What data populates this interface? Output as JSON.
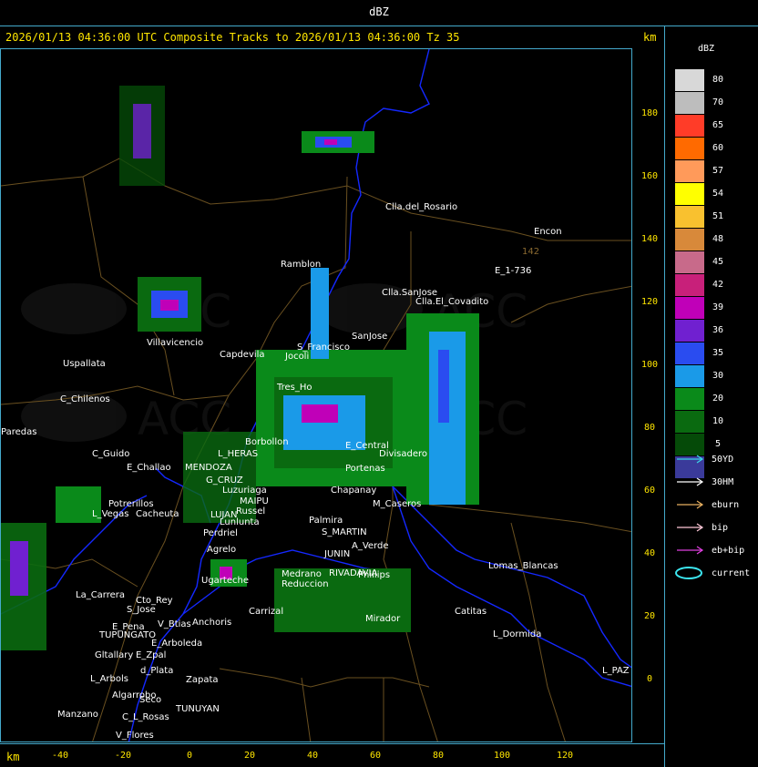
{
  "app": {
    "title": "dBZ"
  },
  "header": {
    "text": "2026/01/13 04:36:00 UTC Composite Tracks to 2026/01/13 04:36:00 Tz 35",
    "km_top": "km",
    "km_bottom": "km"
  },
  "y_ticks": [
    {
      "label": "180",
      "value": 180
    },
    {
      "label": "160",
      "value": 160
    },
    {
      "label": "140",
      "value": 140
    },
    {
      "label": "120",
      "value": 120
    },
    {
      "label": "100",
      "value": 100
    },
    {
      "label": "80",
      "value": 80
    },
    {
      "label": "60",
      "value": 60
    },
    {
      "label": "40",
      "value": 40
    },
    {
      "label": "20",
      "value": 20
    },
    {
      "label": "0",
      "value": 0
    }
  ],
  "x_ticks": [
    {
      "label": "-40",
      "value": -40
    },
    {
      "label": "-20",
      "value": -20
    },
    {
      "label": "0",
      "value": 0
    },
    {
      "label": "20",
      "value": 20
    },
    {
      "label": "40",
      "value": 40
    },
    {
      "label": "60",
      "value": 60
    },
    {
      "label": "80",
      "value": 80
    },
    {
      "label": "100",
      "value": 100
    },
    {
      "label": "120",
      "value": 120
    }
  ],
  "legend": {
    "title": "dBZ",
    "bins": [
      {
        "label": "80",
        "color": "#d8d8d8"
      },
      {
        "label": "70",
        "color": "#bdbdbd"
      },
      {
        "label": "65",
        "color": "#ff3c28"
      },
      {
        "label": "60",
        "color": "#ff6a00"
      },
      {
        "label": "57",
        "color": "#ff9a5a"
      },
      {
        "label": "54",
        "color": "#ffff00"
      },
      {
        "label": "51",
        "color": "#f9c12f"
      },
      {
        "label": "48",
        "color": "#d8893a"
      },
      {
        "label": "45",
        "color": "#c86a8a"
      },
      {
        "label": "42",
        "color": "#c8207a"
      },
      {
        "label": "39",
        "color": "#c000b8"
      },
      {
        "label": "36",
        "color": "#7020d0"
      },
      {
        "label": "35",
        "color": "#2a4cf0"
      },
      {
        "label": "30",
        "color": "#1a9ae8"
      },
      {
        "label": "20",
        "color": "#0a8a1a"
      },
      {
        "label": "10",
        "color": "#0a6a10"
      },
      {
        "label": "5",
        "color": "#054a08"
      },
      {
        "label": "",
        "color": "#3a3a9a"
      }
    ],
    "tracks": [
      {
        "label": "50YD",
        "color": "#3cd6e6"
      },
      {
        "label": "30HM",
        "color": "#ffffff"
      },
      {
        "label": "eburn",
        "color": "#e8b060"
      },
      {
        "label": "bip",
        "color": "#ffc8d8"
      },
      {
        "label": "eb+bip",
        "color": "#e040e0"
      },
      {
        "label": "current",
        "color": "#3ce6f0"
      }
    ]
  },
  "places": [
    {
      "name": "Clla.del_Rosario"
    },
    {
      "name": "Encon"
    },
    {
      "name": "142"
    },
    {
      "name": "E_1-736"
    },
    {
      "name": "Ramblon"
    },
    {
      "name": "Clla.SanJose"
    },
    {
      "name": "Clla.El_Covadito"
    },
    {
      "name": "Villavicencio"
    },
    {
      "name": "Uspallata"
    },
    {
      "name": "Capdevila"
    },
    {
      "name": "S_Francisco"
    },
    {
      "name": "Jocoli"
    },
    {
      "name": "SanJose"
    },
    {
      "name": "C_Chilenos"
    },
    {
      "name": "Paredas"
    },
    {
      "name": "Tres_Ho"
    },
    {
      "name": "C_Guido"
    },
    {
      "name": "E_Challao"
    },
    {
      "name": "L_HERAS"
    },
    {
      "name": "MENDOZA"
    },
    {
      "name": "G_CRUZ"
    },
    {
      "name": "Luzuriaga"
    },
    {
      "name": "Borbollon"
    },
    {
      "name": "E_Central"
    },
    {
      "name": "Divisadero"
    },
    {
      "name": "Portenas"
    },
    {
      "name": "Chapanay"
    },
    {
      "name": "Potrerillos"
    },
    {
      "name": "L_Vegas"
    },
    {
      "name": "Cacheuta"
    },
    {
      "name": "MAIPU"
    },
    {
      "name": "Russel"
    },
    {
      "name": "LUJAN"
    },
    {
      "name": "Lunlunta"
    },
    {
      "name": "Perdriel"
    },
    {
      "name": "Agrelo"
    },
    {
      "name": "Palmira"
    },
    {
      "name": "S_MARTIN"
    },
    {
      "name": "M_Caseros"
    },
    {
      "name": "A_Verde"
    },
    {
      "name": "Ugarteche"
    },
    {
      "name": "JUNIN"
    },
    {
      "name": "RIVADAVIA"
    },
    {
      "name": "Medrano"
    },
    {
      "name": "Reduccion"
    },
    {
      "name": "Phillips"
    },
    {
      "name": "Lomas_Blancas"
    },
    {
      "name": "La_Carrera"
    },
    {
      "name": "Cto_Rey"
    },
    {
      "name": "S_Jose"
    },
    {
      "name": "Carrizal"
    },
    {
      "name": "Catitas"
    },
    {
      "name": "E_Pena"
    },
    {
      "name": "TUPUNGATO"
    },
    {
      "name": "V_Btias"
    },
    {
      "name": "Anchoris"
    },
    {
      "name": "Mirador"
    },
    {
      "name": "L_Dormida"
    },
    {
      "name": "E_Arboleda"
    },
    {
      "name": "Gltallary"
    },
    {
      "name": "E_Zpal"
    },
    {
      "name": "L_Arbols"
    },
    {
      "name": "d_Plata"
    },
    {
      "name": "Zapata"
    },
    {
      "name": "L_PAZ"
    },
    {
      "name": "Algarrobo"
    },
    {
      "name": "Seco"
    },
    {
      "name": "TUNUYAN"
    },
    {
      "name": "Manzano"
    },
    {
      "name": "C_L_Rosas"
    },
    {
      "name": "V_Flores"
    }
  ]
}
